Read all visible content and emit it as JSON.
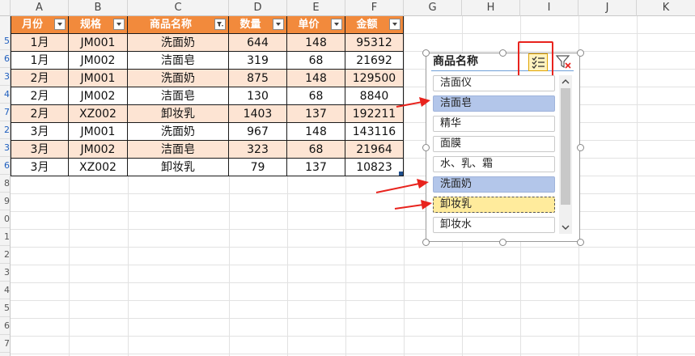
{
  "columns": [
    "A",
    "B",
    "C",
    "D",
    "E",
    "F",
    "G",
    "H",
    "I",
    "J",
    "K"
  ],
  "row_numbers": [
    "5",
    "6",
    "3",
    "4",
    "7",
    "2",
    "3",
    "6",
    "8",
    "9",
    "0",
    "1",
    "2",
    "3",
    "4",
    "5",
    "6",
    "7"
  ],
  "table": {
    "headers": [
      "月份",
      "规格",
      "商品名称",
      "数量",
      "单价",
      "金额"
    ],
    "rows": [
      [
        "1月",
        "JM001",
        "洗面奶",
        "644",
        "148",
        "95312"
      ],
      [
        "1月",
        "JM002",
        "洁面皂",
        "319",
        "68",
        "21692"
      ],
      [
        "2月",
        "JM001",
        "洗面奶",
        "875",
        "148",
        "129500"
      ],
      [
        "2月",
        "JM002",
        "洁面皂",
        "130",
        "68",
        "8840"
      ],
      [
        "2月",
        "XZ002",
        "卸妆乳",
        "1403",
        "137",
        "192211"
      ],
      [
        "3月",
        "JM001",
        "洗面奶",
        "967",
        "148",
        "143116"
      ],
      [
        "3月",
        "JM002",
        "洁面皂",
        "323",
        "68",
        "21964"
      ],
      [
        "3月",
        "XZ002",
        "卸妆乳",
        "79",
        "137",
        "10823"
      ]
    ]
  },
  "slicer": {
    "title": "商品名称",
    "items": [
      {
        "label": "洁面仪",
        "state": "normal"
      },
      {
        "label": "洁面皂",
        "state": "selected"
      },
      {
        "label": "精华",
        "state": "normal"
      },
      {
        "label": "面膜",
        "state": "normal"
      },
      {
        "label": "水、乳、霜",
        "state": "normal"
      },
      {
        "label": "洗面奶",
        "state": "selected"
      },
      {
        "label": "卸妆乳",
        "state": "hover"
      },
      {
        "label": "卸妆水",
        "state": "normal"
      }
    ],
    "multiselect_icon": "multi-select-icon",
    "clear_filter_icon": "clear-filter-icon"
  },
  "colors": {
    "header_orange": "#f28a3c",
    "band_peach": "#fde4d3",
    "selected_blue": "#b3c6ea",
    "hover_yellow": "#ffeb9c",
    "annotation_red": "#e8231d"
  }
}
